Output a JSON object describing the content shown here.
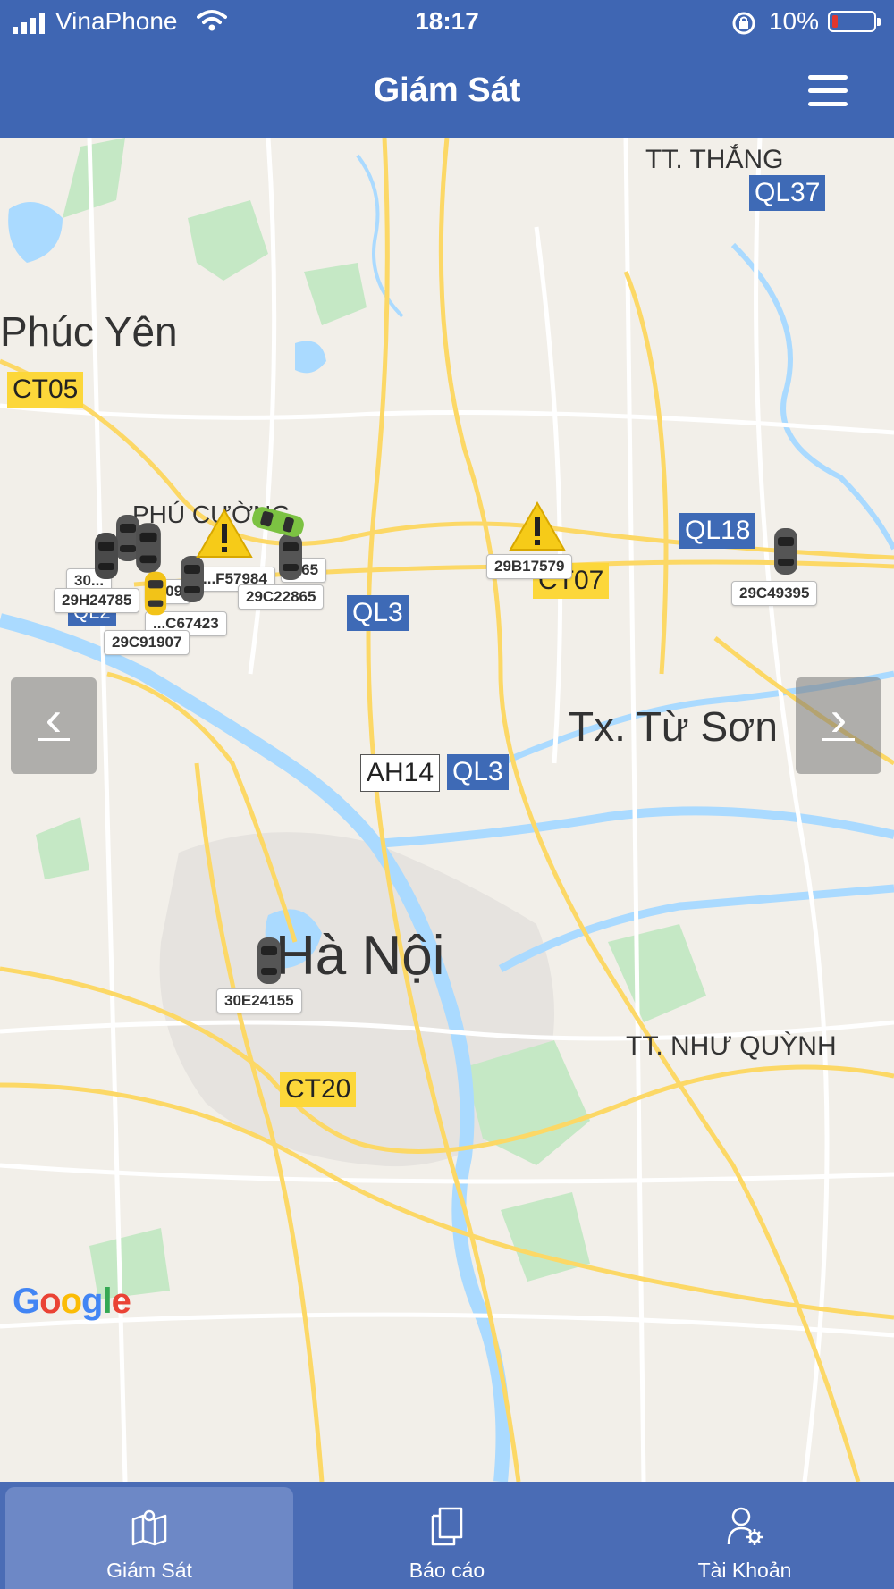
{
  "status_bar": {
    "carrier": "VinaPhone",
    "time": "18:17",
    "battery": "10%",
    "battery_level": 0.1
  },
  "header": {
    "title": "Giám Sát",
    "menu_icon": "hamburger-menu-icon"
  },
  "map": {
    "places": {
      "tt_thang": "TT. THẮNG",
      "phuc_yen": "Phúc Yên",
      "phu_cuong": "PHÚ CƯỜNG",
      "tu_son": "Tx. Từ Sơn",
      "ha_noi": "Hà Nội",
      "nhu_quynh": "TT. NHƯ QUỲNH"
    },
    "shields": {
      "ql37": "QL37",
      "ct05": "CT05",
      "ql18": "QL18",
      "ct07": "CT07",
      "ql3_a": "QL3",
      "ql2": "QL2",
      "ah14": "AH14",
      "ql3_b": "QL3",
      "ct20": "CT20"
    },
    "plates": {
      "p1": "30...",
      "p2": "29H24785",
      "p3": "...09",
      "p4": "...F57984",
      "p5": "...65",
      "p6": "29C22865",
      "p7": "...C67423",
      "p8": "29C91907",
      "p9": "29B17579",
      "p10": "29C49395",
      "p11": "30E24155"
    },
    "attribution": "Google",
    "nav": {
      "prev": "‹",
      "next": "›"
    }
  },
  "tabs": [
    {
      "label": "Giám Sát",
      "icon": "map-icon",
      "active": true
    },
    {
      "label": "Báo cáo",
      "icon": "documents-icon",
      "active": false
    },
    {
      "label": "Tài Khoản",
      "icon": "user-settings-icon",
      "active": false
    }
  ],
  "colors": {
    "primary": "#3f66b3",
    "tabbar": "#4a6cb5",
    "active_tab": "#6d88c6",
    "road": "#fcd866",
    "water": "#aadaff",
    "park": "#c5e8c5"
  }
}
